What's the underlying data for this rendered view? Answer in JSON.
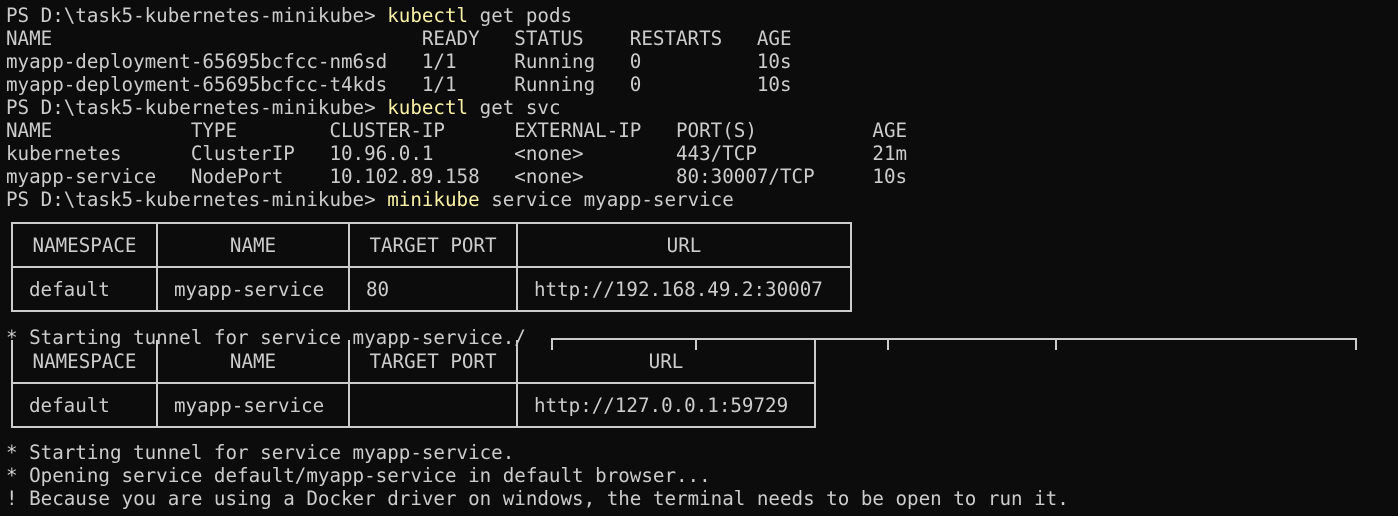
{
  "prompt": "PS D:\\task5-kubernetes-minikube> ",
  "cmd1": {
    "tool": "kubectl",
    "rest": " get pods"
  },
  "pods_header": "NAME                                READY   STATUS    RESTARTS   AGE",
  "pods_rows": [
    "myapp-deployment-65695bcfcc-nm6sd   1/1     Running   0          10s",
    "myapp-deployment-65695bcfcc-t4kds   1/1     Running   0          10s"
  ],
  "cmd2": {
    "tool": "kubectl",
    "rest": " get svc"
  },
  "svc_header": "NAME            TYPE        CLUSTER-IP      EXTERNAL-IP   PORT(S)          AGE",
  "svc_rows": [
    "kubernetes      ClusterIP   10.96.0.1       <none>        443/TCP          21m",
    "myapp-service   NodePort    10.102.89.158   <none>        80:30007/TCP     10s"
  ],
  "cmd3": {
    "tool": "minikube",
    "rest": " service myapp-service"
  },
  "table1": {
    "headers": [
      "NAMESPACE",
      "NAME",
      "TARGET PORT",
      "URL"
    ],
    "row": [
      "default",
      "myapp-service",
      "80",
      "http://192.168.49.2:30007"
    ]
  },
  "tunnel_line1": "* Starting tunnel for service myapp-service./",
  "table2": {
    "headers": [
      "NAMESPACE",
      "NAME",
      "TARGET PORT",
      "URL"
    ],
    "row": [
      "default",
      "myapp-service",
      "",
      "http://127.0.0.1:59729"
    ]
  },
  "messages": [
    "* Starting tunnel for service myapp-service.",
    "* Opening service default/myapp-service in default browser...",
    "! Because you are using a Docker driver on windows, the terminal needs to be open to run it."
  ],
  "colors": {
    "background": "#0c0c0c",
    "text": "#cccccc",
    "command": "#f9f1a5"
  }
}
